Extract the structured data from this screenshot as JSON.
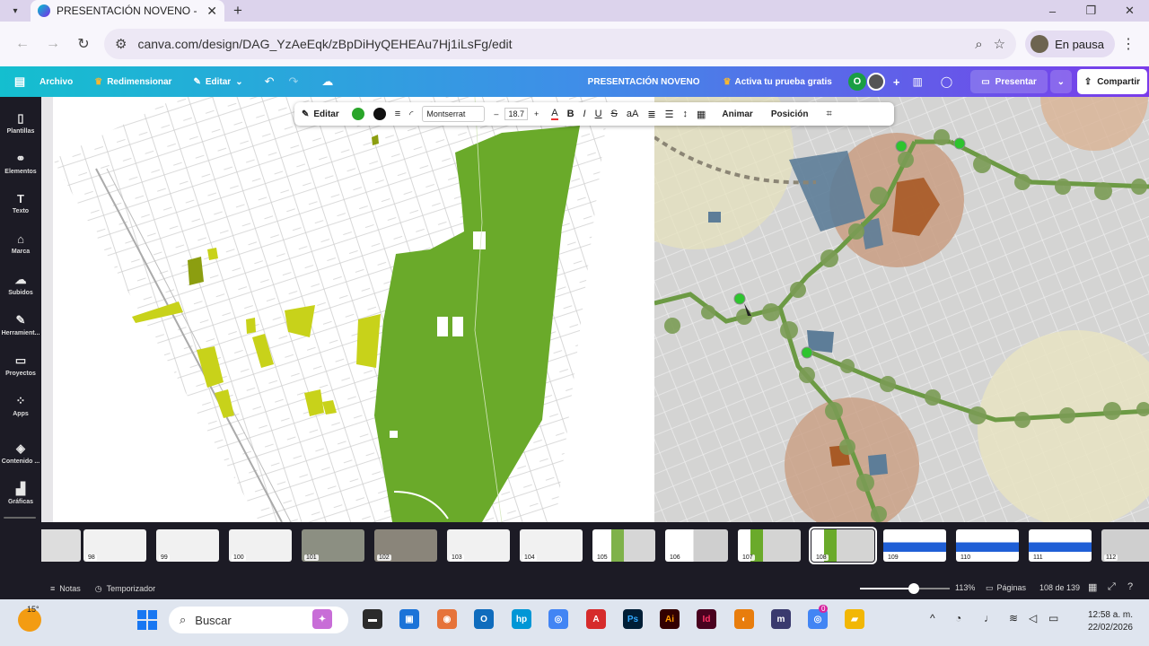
{
  "browser": {
    "tab_title": "PRESENTACIÓN NOVENO - Pre",
    "url": "canva.com/design/DAG_YzAeEqk/zBpDiHyQEHEAu7Hj1iLsFg/edit",
    "profile_label": "En pausa"
  },
  "canva_header": {
    "file": "Archivo",
    "resize": "Redimensionar",
    "edit": "Editar",
    "doc_title": "PRESENTACIÓN NOVENO",
    "trial": "Activa tu prueba gratis",
    "avatar_letter": "O",
    "present": "Presentar",
    "share": "Compartir"
  },
  "sidebar": {
    "items": [
      {
        "label": "Plantillas",
        "icon": "templates-icon"
      },
      {
        "label": "Elementos",
        "icon": "elements-icon"
      },
      {
        "label": "Texto",
        "icon": "text-icon"
      },
      {
        "label": "Marca",
        "icon": "brand-icon"
      },
      {
        "label": "Subidos",
        "icon": "uploads-icon"
      },
      {
        "label": "Herramient...",
        "icon": "tools-icon"
      },
      {
        "label": "Proyectos",
        "icon": "projects-icon"
      },
      {
        "label": "Apps",
        "icon": "apps-icon"
      },
      {
        "label": "Contenido ...",
        "icon": "content-icon"
      },
      {
        "label": "Gráficas",
        "icon": "charts-icon"
      }
    ]
  },
  "text_toolbar": {
    "edit": "Editar",
    "font": "Montserrat",
    "size_minus": "–",
    "size": "18.7",
    "size_plus": "+",
    "bold": "B",
    "italic": "I",
    "underline": "U",
    "strike": "S",
    "case": "aA",
    "animate": "Animar",
    "position": "Posición"
  },
  "thumbnails": [
    {
      "num": "98"
    },
    {
      "num": "99"
    },
    {
      "num": "100"
    },
    {
      "num": "101"
    },
    {
      "num": "102"
    },
    {
      "num": "103"
    },
    {
      "num": "104"
    },
    {
      "num": "105"
    },
    {
      "num": "106"
    },
    {
      "num": "107"
    },
    {
      "num": "108",
      "selected": true
    },
    {
      "num": "109"
    },
    {
      "num": "110"
    },
    {
      "num": "111"
    },
    {
      "num": "112"
    }
  ],
  "bottom_bar": {
    "notes": "Notas",
    "timer": "Temporizador",
    "zoom_fraction": 0.6,
    "zoom": "113%",
    "pages": "Páginas",
    "page_count": "108 de 139"
  },
  "taskbar": {
    "temperature": "15°",
    "search": "Buscar",
    "time": "12:58 a. m.",
    "date": "22/02/2026",
    "notification_count": "0"
  }
}
